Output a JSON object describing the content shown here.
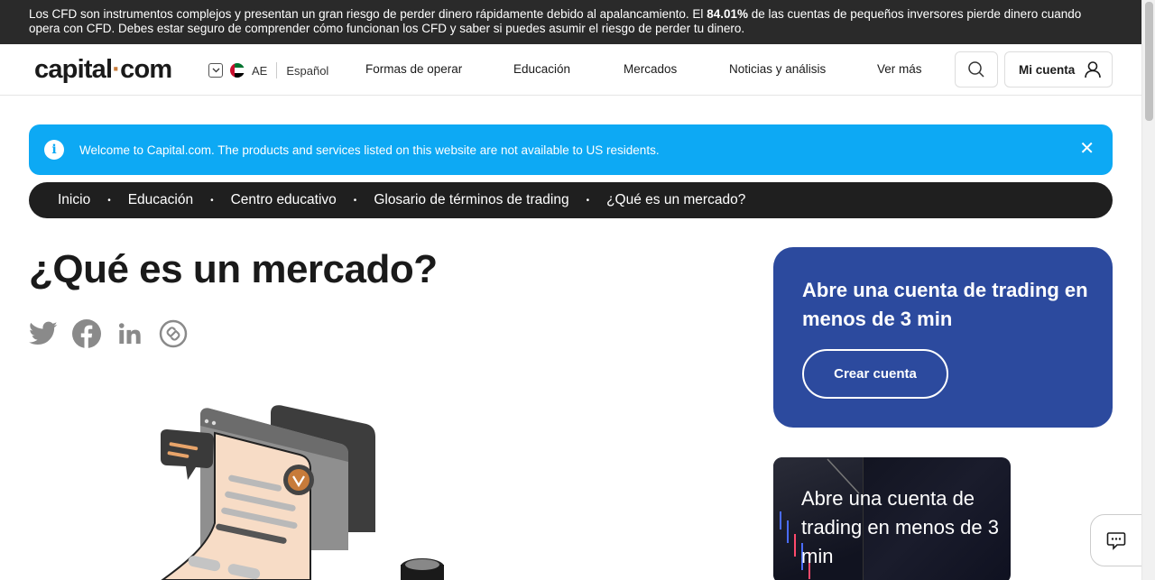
{
  "risk_warning": {
    "text_before": "Los CFD son instrumentos complejos y presentan un gran riesgo de perder dinero rápidamente debido al apalancamiento. El ",
    "percentage": "84.01%",
    "text_after": " de las cuentas de pequeños inversores pierde dinero cuando opera con CFD. Debes estar seguro de comprender cómo funcionan los CFD y saber si puedes asumir el riesgo de perder tu dinero."
  },
  "header": {
    "logo_left": "capital",
    "logo_dot": "·",
    "logo_right": "com",
    "region_code": "AE",
    "language": "Español",
    "nav": [
      "Formas de operar",
      "Educación",
      "Mercados",
      "Noticias y análisis",
      "Ver más"
    ],
    "account_label": "Mi cuenta"
  },
  "notice": {
    "text": "Welcome to Capital.com. The products and services listed on this website are not available to US residents.",
    "close_glyph": "✕"
  },
  "breadcrumb": [
    "Inicio",
    "Educación",
    "Centro educativo",
    "Glosario de términos de trading",
    "¿Qué es un mercado?"
  ],
  "breadcrumb_separator": "•",
  "page": {
    "title": "¿Qué es un mercado?"
  },
  "social_icons": [
    "twitter-icon",
    "facebook-icon",
    "linkedin-icon",
    "copy-link-icon"
  ],
  "cta_card": {
    "heading": "Abre una cuenta de trading en menos de 3 min",
    "button": "Crear cuenta"
  },
  "promo": {
    "text": "Abre una cuenta de trading en menos de 3 min"
  },
  "colors": {
    "risk_bar_bg": "#2a2a2a",
    "notice_bg": "#0da9f4",
    "breadcrumb_bg": "#1f1f1f",
    "cta_bg": "#2c4a9e",
    "logo_accent": "#c77b3a"
  }
}
